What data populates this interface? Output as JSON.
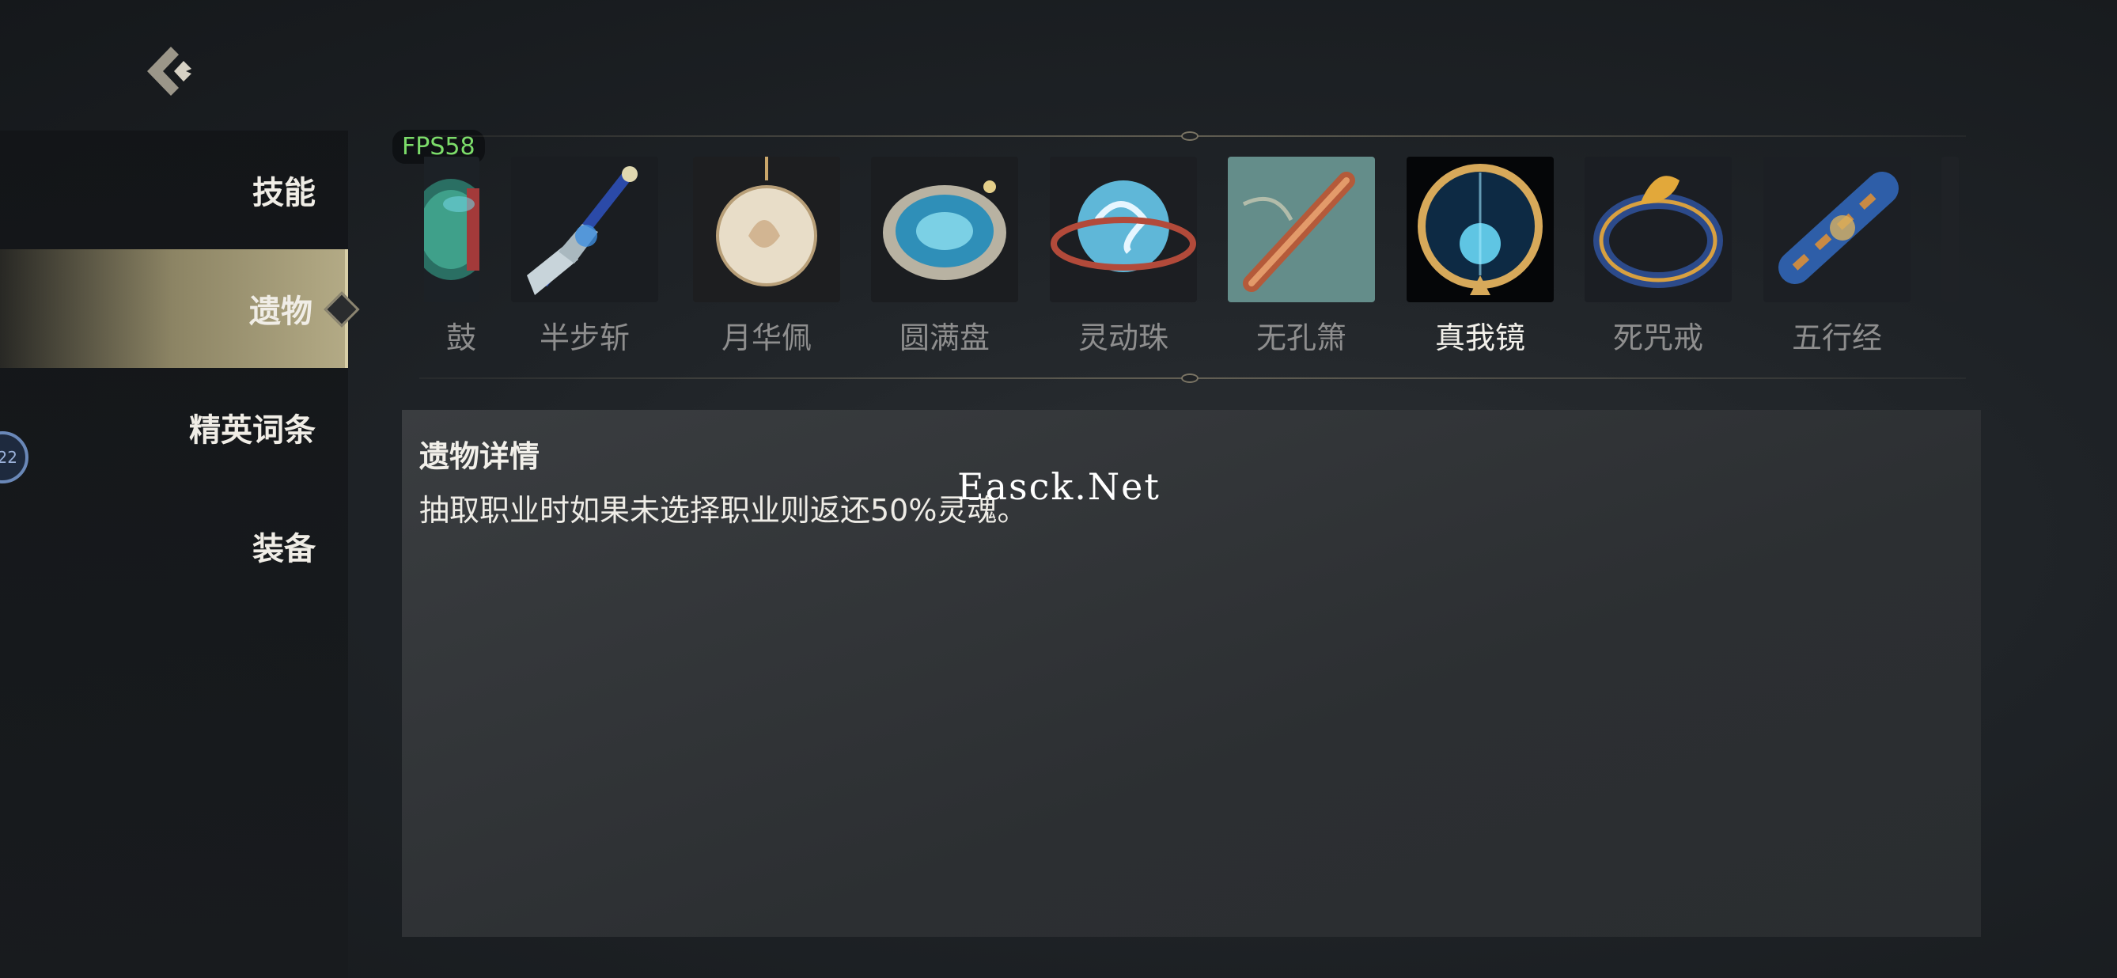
{
  "back": {
    "icon": "back-chevron-icon"
  },
  "sidebar": {
    "items": [
      {
        "label": "技能",
        "active": false
      },
      {
        "label": "遗物",
        "active": true
      },
      {
        "label": "精英词条",
        "active": false
      },
      {
        "label": "装备",
        "active": false
      }
    ],
    "badge": "22"
  },
  "fps": "FPS58",
  "relics": [
    {
      "name": "鼓"
    },
    {
      "name": "半步斩"
    },
    {
      "name": "月华佩"
    },
    {
      "name": "圆满盘"
    },
    {
      "name": "灵动珠"
    },
    {
      "name": "无孔箫"
    },
    {
      "name": "真我镜",
      "selected": true
    },
    {
      "name": "死咒戒"
    },
    {
      "name": "五行经"
    }
  ],
  "detail": {
    "title": "遗物详情",
    "text": "抽取职业时如果未选择职业则返还50%灵魂。"
  },
  "watermark": "Easck.Net",
  "colors": {
    "accent": "#b3aa85",
    "fps": "#7cdc6a",
    "selected_text": "#f2f0ea",
    "muted_text": "#8e8e8e"
  }
}
